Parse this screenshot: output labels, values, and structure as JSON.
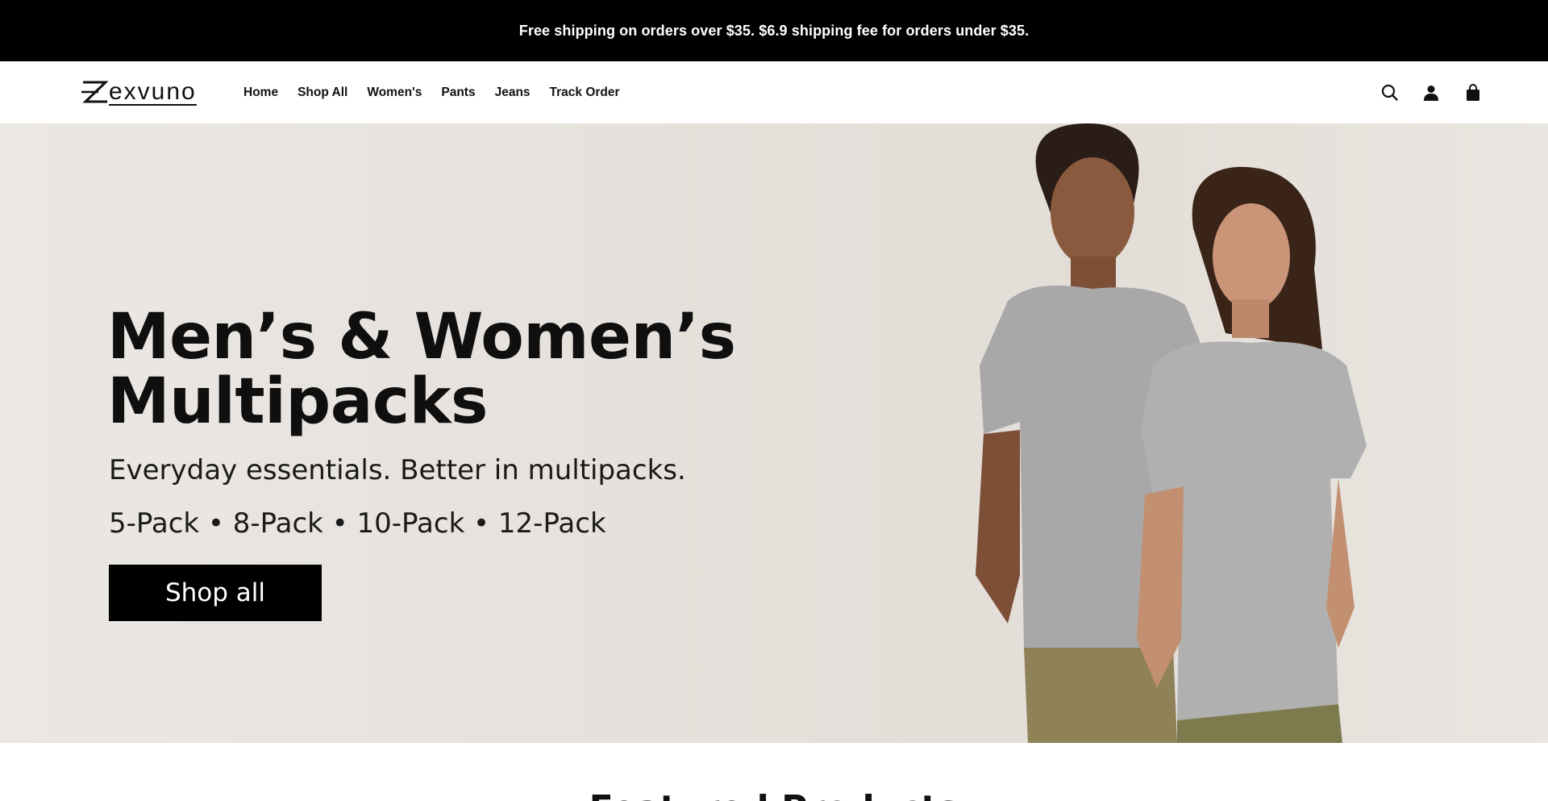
{
  "announcement": "Free shipping on orders over $35. $6.9 shipping fee for orders under $35.",
  "brand": {
    "name": "exvuno",
    "logo_letter": "Z"
  },
  "nav": {
    "items": [
      "Home",
      "Shop All",
      "Women's",
      "Pants",
      "Jeans",
      "Track Order"
    ]
  },
  "header_icons": [
    "search-icon",
    "account-icon",
    "cart-icon"
  ],
  "hero": {
    "title_line1": "Men’s & Women’s",
    "title_line2": "Multipacks",
    "subtitle": "Everyday essentials. Better in multipacks.",
    "packs": "5-Pack • 8-Pack • 10-Pack • 12-Pack",
    "cta": "Shop all"
  },
  "featured": {
    "heading": "Featured Products"
  },
  "colors": {
    "announcement_bg": "#000000",
    "hero_bg": "#e6e1dc",
    "cta_bg": "#000000",
    "tshirt_grey": "#a9a9a9",
    "pants_olive": "#8f8259"
  }
}
